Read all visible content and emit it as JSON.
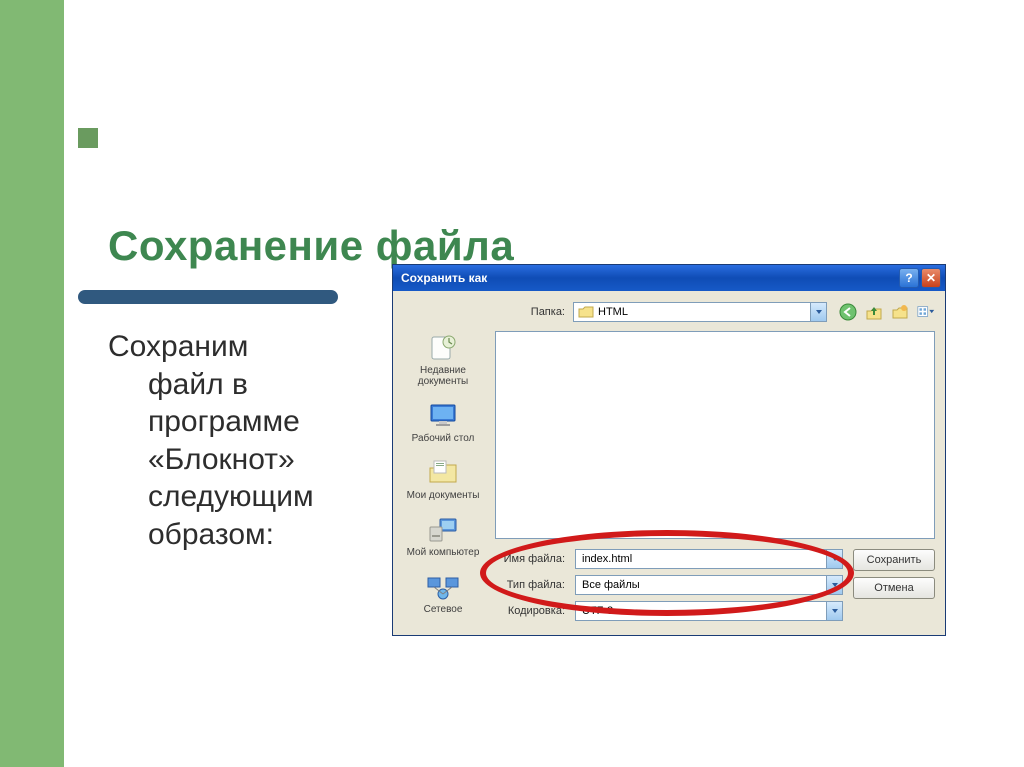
{
  "slide": {
    "title": "Сохранение файла",
    "body_first": "Сохраним",
    "body_rest": "файл в программе «Блокнот» следующим образом:",
    "watermark": ""
  },
  "dialog": {
    "title": "Сохранить как",
    "top": {
      "folder_label": "Папка:",
      "folder_value": "HTML"
    },
    "places": [
      {
        "id": "recent",
        "label": "Недавние документы"
      },
      {
        "id": "desktop",
        "label": "Рабочий стол"
      },
      {
        "id": "mydocs",
        "label": "Мои документы"
      },
      {
        "id": "mycomp",
        "label": "Мой компьютер"
      },
      {
        "id": "network",
        "label": "Сетевое"
      }
    ],
    "fields": {
      "filename_label": "Имя файла:",
      "filename_value": "index.html",
      "filetype_label": "Тип файла:",
      "filetype_value": "Все файлы",
      "encoding_label": "Кодировка:",
      "encoding_value": "UTF-8"
    },
    "buttons": {
      "save": "Сохранить",
      "cancel": "Отмена"
    }
  }
}
